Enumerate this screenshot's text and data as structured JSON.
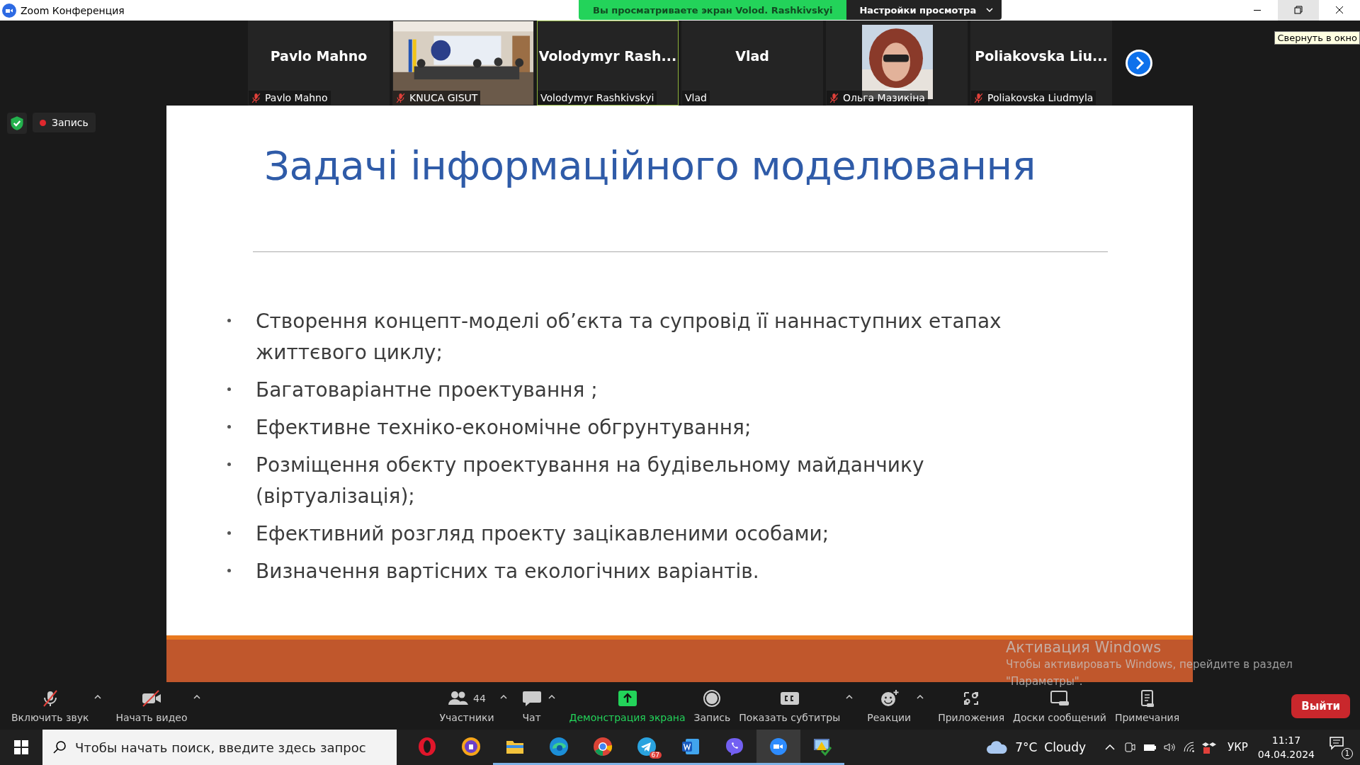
{
  "window": {
    "title": "Zoom Конференция"
  },
  "share_banner": {
    "text": "Вы просматриваете экран Volod. Rashkivskyi",
    "view_options": "Настройки просмотра"
  },
  "tooltip": "Свернуть в окно",
  "participants": [
    {
      "kind": "name",
      "display": "Pavlo Mahno",
      "label": "Pavlo Mahno",
      "muted": true,
      "speaking": false
    },
    {
      "kind": "video",
      "label": "KNUCA GISUT",
      "muted": true,
      "speaking": false
    },
    {
      "kind": "name",
      "display": "Volodymyr  Rash...",
      "label": "Volodymyr Rashkivskyi",
      "muted": false,
      "speaking": true
    },
    {
      "kind": "name",
      "display": "Vlad",
      "label": "Vlad",
      "muted": false,
      "speaking": false
    },
    {
      "label": "Ольга Мазикіна",
      "muted": true,
      "speaking": false
    },
    {
      "kind": "name",
      "display": "Poliakovska  Liu...",
      "label": "Poliakovska Liudmyla",
      "muted": true,
      "speaking": false
    }
  ],
  "recording": {
    "label": "Запись"
  },
  "slide": {
    "title": "Задачі інформаційного моделювання",
    "bullets": [
      "Створення концепт-моделі об’єкта та супровід її наннаступних етапах життєвого циклу;",
      "Багатоваріантне проектування ;",
      "Ефективне техніко-економічне обгрунтування;",
      "Розміщення обєкту проектування на будівельному майданчику (віртуалізація);",
      "Ефективний розгляд проекту зацікавленими особами;",
      "Визначення вартісних та екологічних варіантів."
    ]
  },
  "activation_notice": {
    "title": "Активация Windows",
    "text": "Чтобы активировать Windows, перейдите в раздел \"Параметры\"."
  },
  "toolbar": [
    {
      "kind": "mic",
      "label": "Включить звук",
      "caret": true,
      "highlighted": false
    },
    {
      "kind": "camera",
      "label": "Начать видео",
      "caret": true,
      "highlighted": false
    },
    {
      "kind": "people",
      "label": "Участники",
      "count": "44",
      "caret": true,
      "highlighted": false
    },
    {
      "kind": "chat",
      "label": "Чат",
      "caret": true,
      "highlighted": false
    },
    {
      "kind": "share",
      "label": "Демонстрация экрана",
      "caret": false,
      "highlighted": true
    },
    {
      "kind": "record",
      "label": "Запись",
      "caret": false,
      "highlighted": false
    },
    {
      "kind": "cc",
      "label": "Показать субтитры",
      "caret": true,
      "highlighted": false
    },
    {
      "kind": "smile",
      "label": "Реакции",
      "caret": true,
      "highlighted": false
    },
    {
      "kind": "apps",
      "label": "Приложения",
      "caret": false,
      "highlighted": false
    },
    {
      "kind": "board",
      "label": "Доски сообщений",
      "caret": false,
      "highlighted": false
    },
    {
      "kind": "notes",
      "label": "Примечания",
      "caret": false,
      "highlighted": false
    }
  ],
  "leave_button": "Выйти",
  "taskbar": {
    "search_placeholder": "Чтобы начать поиск, введите здесь запрос",
    "apps": [
      {
        "kind": "opera",
        "open": false
      },
      {
        "kind": "shield",
        "open": false
      },
      {
        "kind": "folder",
        "open": true
      },
      {
        "kind": "edge",
        "open": true
      },
      {
        "kind": "chrome",
        "open": true
      },
      {
        "kind": "telegram",
        "open": true,
        "badge": "67"
      },
      {
        "kind": "word",
        "open": true
      },
      {
        "kind": "viber",
        "open": true
      },
      {
        "kind": "zoom",
        "open": true,
        "selected": true
      },
      {
        "kind": "monitor",
        "open": true
      }
    ],
    "temperature": "7°C",
    "weather": "Cloudy",
    "language": "УКР",
    "time": "11:17",
    "date": "04.04.2024",
    "notifications": "1"
  }
}
